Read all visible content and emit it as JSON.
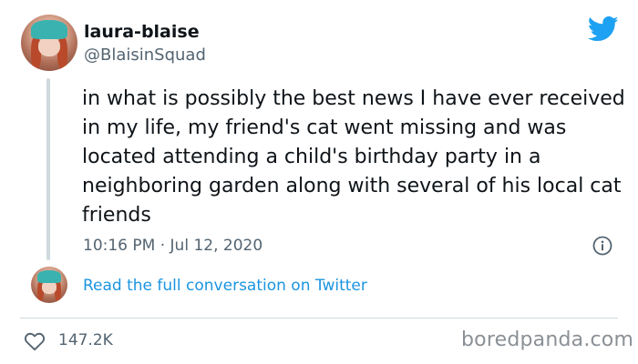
{
  "user": {
    "display_name": "laura-blaise",
    "handle": "@BlaisinSquad"
  },
  "tweet": {
    "text": "in what is possibly the best news I have ever received in my life, my friend's cat went missing and was located attending a child's birthday party in a neighboring garden along with several of his local cat friends",
    "timestamp": "10:16 PM · Jul 12, 2020"
  },
  "conversation_link": "Read the full conversation on Twitter",
  "engagement": {
    "likes": "147.2K"
  },
  "watermark": "boredpanda.com",
  "colors": {
    "twitter_blue": "#1da1f2",
    "link_blue": "#1b95e0",
    "secondary_text": "#536471",
    "divider": "#cfd9de"
  },
  "icons": {
    "brand": "twitter-bird-icon",
    "info": "info-icon",
    "like": "heart-icon"
  }
}
